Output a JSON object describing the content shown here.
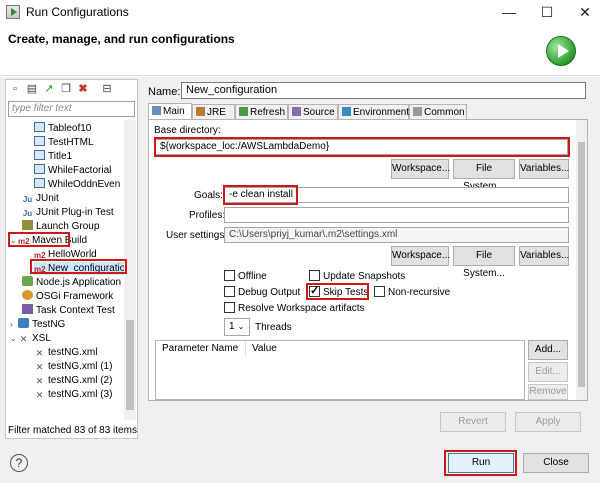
{
  "window": {
    "title": "Run Configurations",
    "minimize": "—",
    "maximize": "☐",
    "close": "✕"
  },
  "header": {
    "title": "Create, manage, and run configurations",
    "icon": "run-icon"
  },
  "left": {
    "toolbar": [
      "new-config-icon",
      "new-prototype-icon",
      "export-icon",
      "duplicate-icon",
      "delete-icon",
      "collapse-all-icon"
    ],
    "filter_placeholder": "type filter text",
    "tree": [
      {
        "label": "Tableof10",
        "indent": 2,
        "icon": "java-app-icon"
      },
      {
        "label": "TestHTML",
        "indent": 2,
        "icon": "java-app-icon"
      },
      {
        "label": "Title1",
        "indent": 2,
        "icon": "java-app-icon"
      },
      {
        "label": "WhileFactorial",
        "indent": 2,
        "icon": "java-app-icon"
      },
      {
        "label": "WhileOddnEven",
        "indent": 2,
        "icon": "java-app-icon"
      },
      {
        "label": "JUnit",
        "indent": 1,
        "icon": "junit-icon"
      },
      {
        "label": "JUnit Plug-in Test",
        "indent": 1,
        "icon": "junit-plugin-icon"
      },
      {
        "label": "Launch Group",
        "indent": 1,
        "icon": "launch-group-icon"
      },
      {
        "label": "Maven Build",
        "indent": 0,
        "icon": "maven-icon",
        "expanded": true
      },
      {
        "label": "HelloWorld",
        "indent": 2,
        "icon": "maven-icon"
      },
      {
        "label": "New_configuration",
        "indent": 2,
        "icon": "maven-icon",
        "selected": true
      },
      {
        "label": "Node.js Application",
        "indent": 1,
        "icon": "nodejs-icon"
      },
      {
        "label": "OSGi Framework",
        "indent": 1,
        "icon": "osgi-icon"
      },
      {
        "label": "Task Context Test",
        "indent": 1,
        "icon": "task-context-icon"
      },
      {
        "label": "TestNG",
        "indent": 0,
        "icon": "testng-icon",
        "collapsed": true
      },
      {
        "label": "XSL",
        "indent": 0,
        "icon": "xsl-icon",
        "expanded": true
      },
      {
        "label": "testNG.xml",
        "indent": 2,
        "icon": "xsl-file-icon"
      },
      {
        "label": "testNG.xml (1)",
        "indent": 2,
        "icon": "xsl-file-icon"
      },
      {
        "label": "testNG.xml (2)",
        "indent": 2,
        "icon": "xsl-file-icon"
      },
      {
        "label": "testNG.xml (3)",
        "indent": 2,
        "icon": "xsl-file-icon"
      }
    ],
    "filter_status": "Filter matched 83 of 83 items"
  },
  "name": {
    "label": "Name:",
    "value": "New_configuration"
  },
  "tabs": [
    {
      "label": "Main",
      "icon": "main-tab-icon"
    },
    {
      "label": "JRE",
      "icon": "jre-tab-icon"
    },
    {
      "label": "Refresh",
      "icon": "refresh-tab-icon"
    },
    {
      "label": "Source",
      "icon": "source-tab-icon"
    },
    {
      "label": "Environment",
      "icon": "environment-tab-icon"
    },
    {
      "label": "Common",
      "icon": "common-tab-icon"
    }
  ],
  "main": {
    "base_dir_label": "Base directory:",
    "base_dir_value": "${workspace_loc:/AWSLambdaDemo}",
    "workspace_btn": "Workspace...",
    "filesystem_btn": "File System...",
    "variables_btn": "Variables...",
    "goals_label": "Goals:",
    "goals_value": "-e clean install",
    "profiles_label": "Profiles:",
    "profiles_value": "",
    "user_settings_label": "User settings:",
    "user_settings_value": "C:\\Users\\priyj_kumar\\.m2\\settings.xml",
    "offline": "Offline",
    "update_snapshots": "Update Snapshots",
    "debug_output": "Debug Output",
    "skip_tests": "Skip Tests",
    "non_recursive": "Non-recursive",
    "resolve_ws": "Resolve Workspace artifacts",
    "threads_value": "1",
    "threads_label": "Threads",
    "param_col_name": "Parameter Name",
    "param_col_value": "Value",
    "add_btn": "Add...",
    "edit_btn": "Edit...",
    "remove_btn": "Remove",
    "skip_tests_checked": true
  },
  "footer": {
    "revert": "Revert",
    "apply": "Apply",
    "run": "Run",
    "close": "Close",
    "help": "?"
  },
  "colors": {
    "highlight": "#d01818",
    "selection": "#cce8ff"
  }
}
